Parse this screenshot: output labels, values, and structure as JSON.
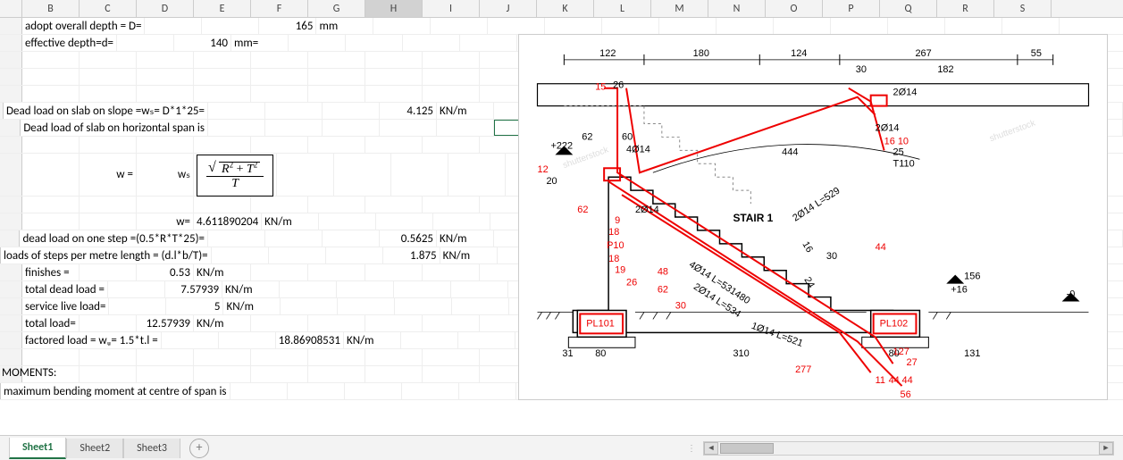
{
  "columns": [
    "B",
    "C",
    "D",
    "E",
    "F",
    "G",
    "H",
    "I",
    "J",
    "K",
    "L",
    "M",
    "N",
    "O",
    "P",
    "Q",
    "R",
    "S"
  ],
  "selected_column": "H",
  "rows": {
    "r1": {
      "b": "adopt overall depth = D=",
      "e": "165",
      "f": "mm"
    },
    "r2": {
      "b": "effective depth=d=",
      "d": "140",
      "e": "mm="
    },
    "r5": {
      "b": "Dead load on slab on slope =wₛ= D*1*25=",
      "f": "4.125",
      "g": "KN/m"
    },
    "r6": {
      "b": "Dead load of slab on horizontal span is"
    },
    "r8": {
      "c": "w =",
      "d": "wₛ"
    },
    "r10": {
      "d": "w=",
      "e": "4.611890204",
      "f": "KN/m"
    },
    "r11": {
      "b": "dead load on one step =(0.5*R*T*25)=",
      "f": "0.5625",
      "g": "KN/m"
    },
    "r12": {
      "b": "loads of steps per metre length = (d.l*b/T)=",
      "f": "1.875",
      "g": "KN/m"
    },
    "r13": {
      "b": "finishes =",
      "d": "0.53",
      "e": "KN/m"
    },
    "r14": {
      "b": "total dead load =",
      "d": "7.57939",
      "e": "KN/m"
    },
    "r15": {
      "b": "service live load=",
      "d": "5",
      "e": "KN/m"
    },
    "r16": {
      "b": "total load=",
      "d": "12.57939",
      "e": "KN/m"
    },
    "r17": {
      "b": "factored load = wᵤ= 1.5*t.l =",
      "e": "18.86908531",
      "f": "KN/m"
    },
    "r19": {
      "a": "MOMENTS:"
    },
    "r20": {
      "b": "maximum bending moment at centre of span is"
    }
  },
  "formula": {
    "ws": "wₛ",
    "R": "R",
    "T": "T"
  },
  "tabs": [
    "Sheet1",
    "Sheet2",
    "Sheet3"
  ],
  "active_tab": 0,
  "diagram": {
    "dims_top": [
      "122",
      "180",
      "124",
      "267",
      "182",
      "55",
      "30"
    ],
    "labels": [
      "15",
      "26",
      "2Ø14",
      "2Ø14",
      "62",
      "60",
      "4Ø14",
      "+222",
      "12",
      "20",
      "16",
      "25",
      "T110",
      "444",
      "62",
      "2Ø14",
      "9",
      "18",
      "P10",
      "18",
      "19",
      "26",
      "48",
      "62",
      "30",
      "STAIR 1",
      "2Ø14 L=529",
      "44",
      "16",
      "30",
      "24",
      "156",
      "+16",
      "-0",
      "4Ø14 L=531480",
      "2Ø14 L=534",
      "1Ø14 L=521",
      "PL101",
      "PL102",
      "80",
      "310",
      "80",
      "131",
      "277",
      "27",
      "11",
      "44",
      "44",
      "56",
      "31",
      "16 10",
      "127"
    ],
    "title": "STAIR 1"
  }
}
